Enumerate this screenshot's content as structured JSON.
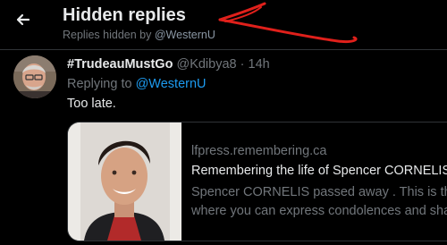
{
  "header": {
    "title": "Hidden replies",
    "subtitle_prefix": "Replies hidden by",
    "subtitle_user": "@WesternU",
    "back_icon": "arrow-left-icon"
  },
  "annotation": {
    "color": "#e0201b"
  },
  "tweet": {
    "display_name": "#TrudeauMustGo",
    "handle": "@Kdibya8",
    "separator": "·",
    "time": "14h",
    "replying_prefix": "Replying to",
    "replying_to": "@WesternU",
    "text": "Too late.",
    "card": {
      "domain": "lfpress.remembering.ca",
      "title": "Remembering the life of Spencer CORNELIS",
      "description_line1": "Spencer CORNELIS passed away . This is the f",
      "description_line2": "where you can express condolences and shar"
    }
  },
  "colors": {
    "background": "#000000",
    "accent": "#1d9bf0",
    "muted": "#71767b"
  }
}
